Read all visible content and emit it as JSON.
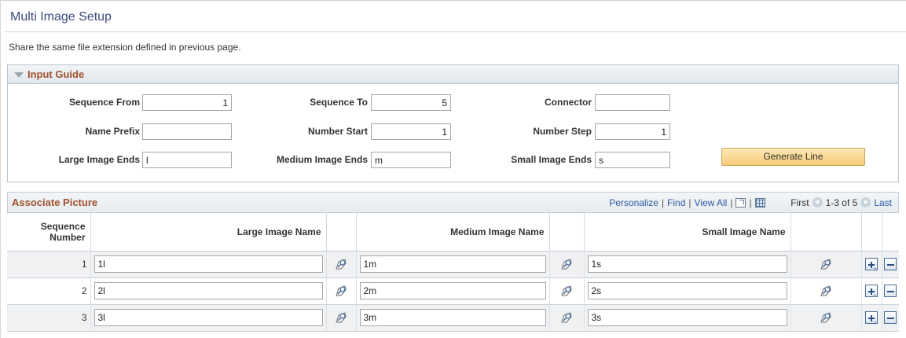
{
  "page": {
    "title": "Multi Image Setup",
    "instruction": "Share the same file extension defined in previous page."
  },
  "input_guide": {
    "title": "Input Guide",
    "fields": {
      "sequence_from": {
        "label": "Sequence From",
        "value": "1"
      },
      "sequence_to": {
        "label": "Sequence To",
        "value": "5"
      },
      "connector": {
        "label": "Connector",
        "value": ""
      },
      "name_prefix": {
        "label": "Name Prefix",
        "value": ""
      },
      "number_start": {
        "label": "Number Start",
        "value": "1"
      },
      "number_step": {
        "label": "Number Step",
        "value": "1"
      },
      "large_image_ends": {
        "label": "Large Image Ends",
        "value": "l"
      },
      "medium_image_ends": {
        "label": "Medium Image Ends",
        "value": "m"
      },
      "small_image_ends": {
        "label": "Small Image Ends",
        "value": "s"
      }
    },
    "generate_button": "Generate Line"
  },
  "associate_picture": {
    "title": "Associate Picture",
    "toolbar": {
      "personalize": "Personalize",
      "find": "Find",
      "view_all": "View All",
      "separator": "|",
      "first": "First",
      "range": "1-3 of 5",
      "last": "Last"
    },
    "columns": {
      "sequence_number": "Sequence Number",
      "large_image_name": "Large Image Name",
      "medium_image_name": "Medium Image Name",
      "small_image_name": "Small Image Name"
    },
    "rows": [
      {
        "seq": "1",
        "large": "1l",
        "medium": "1m",
        "small": "1s"
      },
      {
        "seq": "2",
        "large": "2l",
        "medium": "2m",
        "small": "2s"
      },
      {
        "seq": "3",
        "large": "3l",
        "medium": "3m",
        "small": "3s"
      }
    ]
  },
  "colors": {
    "title_blue": "#3c4b7c",
    "section_brown": "#a0522d",
    "link_blue": "#2c5aa0",
    "button_orange": "#f7cb79"
  },
  "icons": {
    "collapse": "triangle-down-icon",
    "lookup": "lookup-icon",
    "add_row": "plus-icon",
    "delete_row": "minus-icon"
  }
}
